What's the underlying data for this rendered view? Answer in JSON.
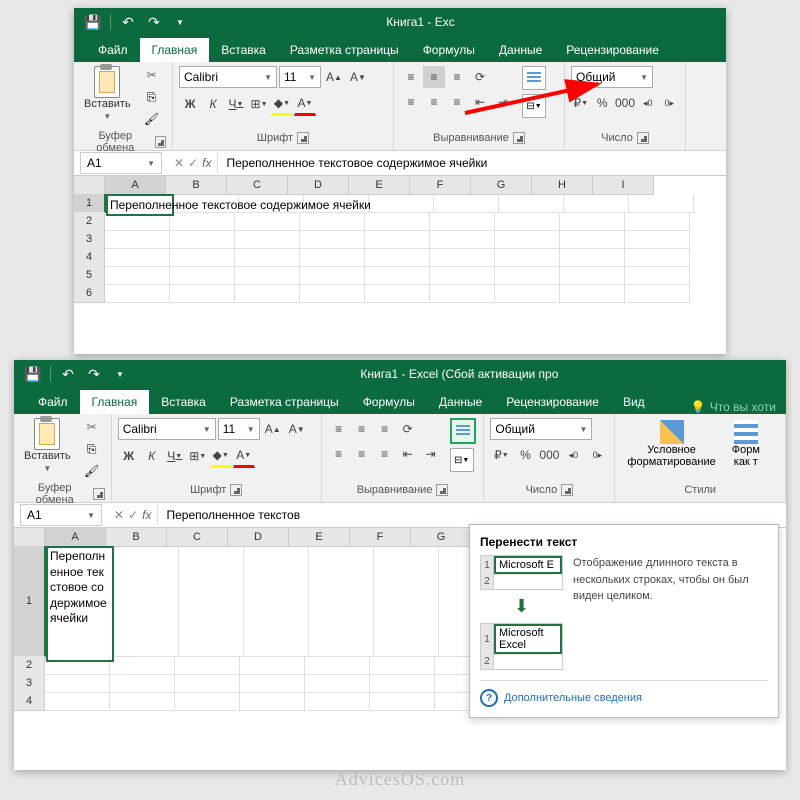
{
  "top": {
    "title": "Книга1 - Exc",
    "tabs": [
      "Файл",
      "Главная",
      "Вставка",
      "Разметка страницы",
      "Формулы",
      "Данные",
      "Рецензирование"
    ],
    "active_tab": 1,
    "paste_label": "Вставить",
    "font_name": "Calibri",
    "font_size": "11",
    "num_format": "Общий",
    "group_clipboard": "Буфер обмена",
    "group_font": "Шрифт",
    "group_align": "Выравнивание",
    "group_number": "Число",
    "cell_ref": "A1",
    "formula": "Переполненное текстовое содержимое ячейки",
    "cols": [
      "A",
      "B",
      "C",
      "D",
      "E",
      "F",
      "G",
      "H",
      "I"
    ],
    "rows": [
      "1",
      "2",
      "3",
      "4",
      "5",
      "6"
    ],
    "cell_a1": "Переполненное текстовое содержимое ячейки"
  },
  "bottom": {
    "title": "Книга1 - Excel (Сбой активации про",
    "tabs": [
      "Файл",
      "Главная",
      "Вставка",
      "Разметка страницы",
      "Формулы",
      "Данные",
      "Рецензирование",
      "Вид"
    ],
    "tell_me": "Что вы хоти",
    "active_tab": 1,
    "paste_label": "Вставить",
    "font_name": "Calibri",
    "font_size": "11",
    "num_format": "Общий",
    "group_clipboard": "Буфер обмена",
    "group_font": "Шрифт",
    "group_align": "Выравнивание",
    "group_number": "Число",
    "cond_fmt": "Условное\nформатирование",
    "fmt_as": "Форм\nкак т",
    "group_styles": "Стили",
    "cell_ref": "A1",
    "formula": "Переполненное текстов",
    "cols": [
      "A",
      "B",
      "C",
      "D",
      "E",
      "F",
      "G"
    ],
    "rows": [
      "1",
      "2",
      "3",
      "4"
    ],
    "cell_a1": "Переполненное текстовое содержимое ячейки",
    "tooltip": {
      "title": "Перенести текст",
      "demo_before": "Microsoft E",
      "demo_after": "Microsoft Excel",
      "text": "Отображение длинного текста в нескольких строках, чтобы он был виден целиком.",
      "more": "Дополнительные сведения"
    }
  },
  "watermark": "AdvicesOS.com"
}
